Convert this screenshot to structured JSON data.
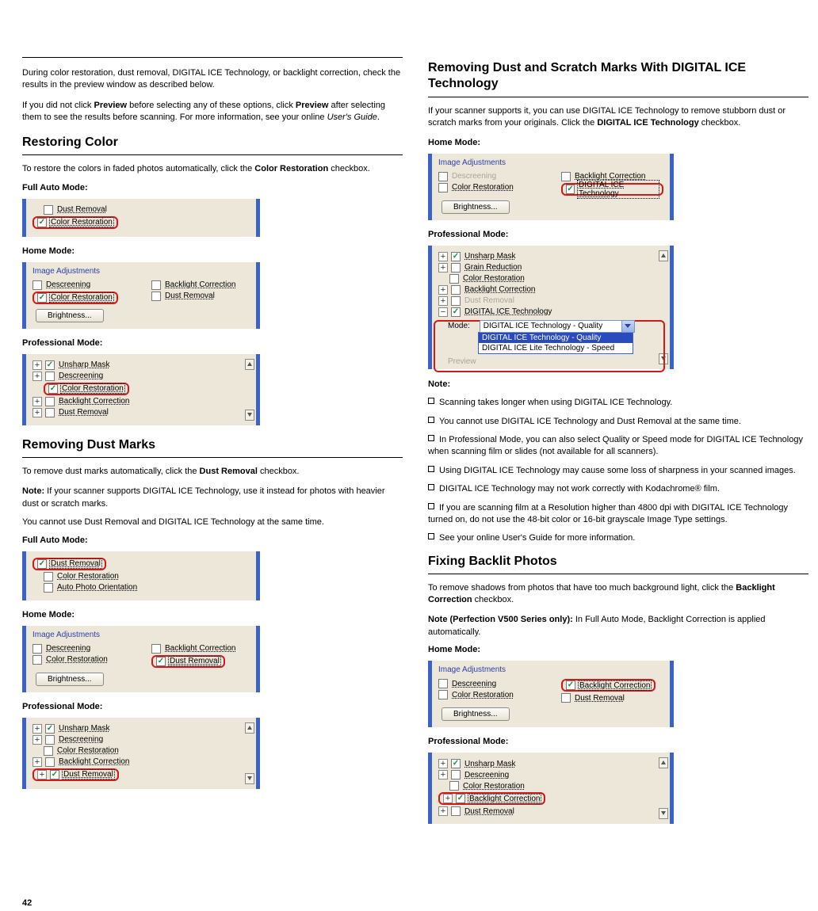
{
  "left": {
    "rule_only": true,
    "heading1": "Restoring Color",
    "intro1": "To restore the colors in faded photos automatically, click the Color Restoration checkbox.",
    "full_label": "Full Auto Mode:",
    "home_label": "Home Mode:",
    "pro_label": "Professional Mode:",
    "panel1": {
      "dust": "Dust Removal",
      "color": "Color Restoration"
    },
    "panel2": {
      "title": "Image Adjustments",
      "descreen": "Descreening",
      "backlight": "Backlight Correction",
      "color": "Color Restoration",
      "dust": "Dust Removal",
      "brightness": "Brightness..."
    },
    "panel3": {
      "unsharp": "Unsharp Mask",
      "descreen": "Descreening",
      "color": "Color Restoration",
      "backlight": "Backlight Correction",
      "dust": "Dust Removal"
    },
    "heading2": "Removing Dust Marks",
    "intro2": "To remove dust marks automatically, click the Dust Removal checkbox.",
    "panel4": {
      "dust": "Dust Removal",
      "color": "Color Restoration",
      "auto": "Auto Photo Orientation"
    },
    "panel5": {
      "title": "Image Adjustments",
      "descreen": "Descreening",
      "backlight": "Backlight Correction",
      "color": "Color Restoration",
      "dust": "Dust Removal",
      "brightness": "Brightness..."
    },
    "panel6": {
      "unsharp": "Unsharp Mask",
      "descreen": "Descreening",
      "color": "Color Restoration",
      "backlight": "Backlight Correction",
      "dust": "Dust Removal"
    },
    "page": "42"
  },
  "right": {
    "heading1": "Removing Dust and Scratch Marks With DIGITAL ICE Technology",
    "intro1": "If your scanner supports it, you can use DIGITAL ICE Technology to remove stubborn dust or scratch marks from your originals. Click the DIGITAL ICE Technology checkbox.",
    "home_label": "Home Mode:",
    "pro_label": "Professional Mode:",
    "panel1": {
      "title": "Image Adjustments",
      "descreen": "Descreening",
      "backlight": "Backlight Correction",
      "color": "Color Restoration",
      "digitalice": "DIGITAL ICE Technology",
      "brightness": "Brightness..."
    },
    "panel2": {
      "unsharp": "Unsharp Mask",
      "grain": "Grain Reduction",
      "color": "Color Restoration",
      "backlight": "Backlight Correction",
      "dust": "Dust Removal",
      "digitalice": "DIGITAL ICE Technology",
      "mode": "Mode:",
      "dd_sel": "DIGITAL ICE Technology - Quality",
      "dd_opt1": "DIGITAL ICE Technology - Quality",
      "dd_opt2": "DIGITAL ICE Lite Technology - Speed",
      "preview": "Preview"
    },
    "notes": [
      "Scanning takes longer when using DIGITAL ICE Technology.",
      "You cannot use DIGITAL ICE Technology and Dust Removal at the same time.",
      "In Professional Mode, you can also select Quality or Speed mode for DIGITAL ICE Technology when scanning film or slides (not available for all scanners).",
      "Using DIGITAL ICE Technology may cause some loss of sharpness in your scanned images.",
      "DIGITAL ICE Technology may not work correctly with Kodachrome® film.",
      "If you are scanning film at a Resolution higher than 4800 dpi with DIGITAL ICE Technology turned on, do not use the 48-bit color or 16-bit grayscale Image Type settings.",
      "See your online User's Guide for more information."
    ],
    "heading2": "Fixing Backlit Photos",
    "intro2": "To remove shadows from photos that have too much background light, click the Backlight Correction checkbox.",
    "panel3": {
      "title": "Image Adjustments",
      "descreen": "Descreening",
      "backlight": "Backlight Correction",
      "color": "Color Restoration",
      "dust": "Dust Removal",
      "brightness": "Brightness..."
    },
    "panel4": {
      "unsharp": "Unsharp Mask",
      "descreen": "Descreening",
      "color": "Color Restoration",
      "backlight": "Backlight Correction",
      "dust": "Dust Removal"
    }
  }
}
